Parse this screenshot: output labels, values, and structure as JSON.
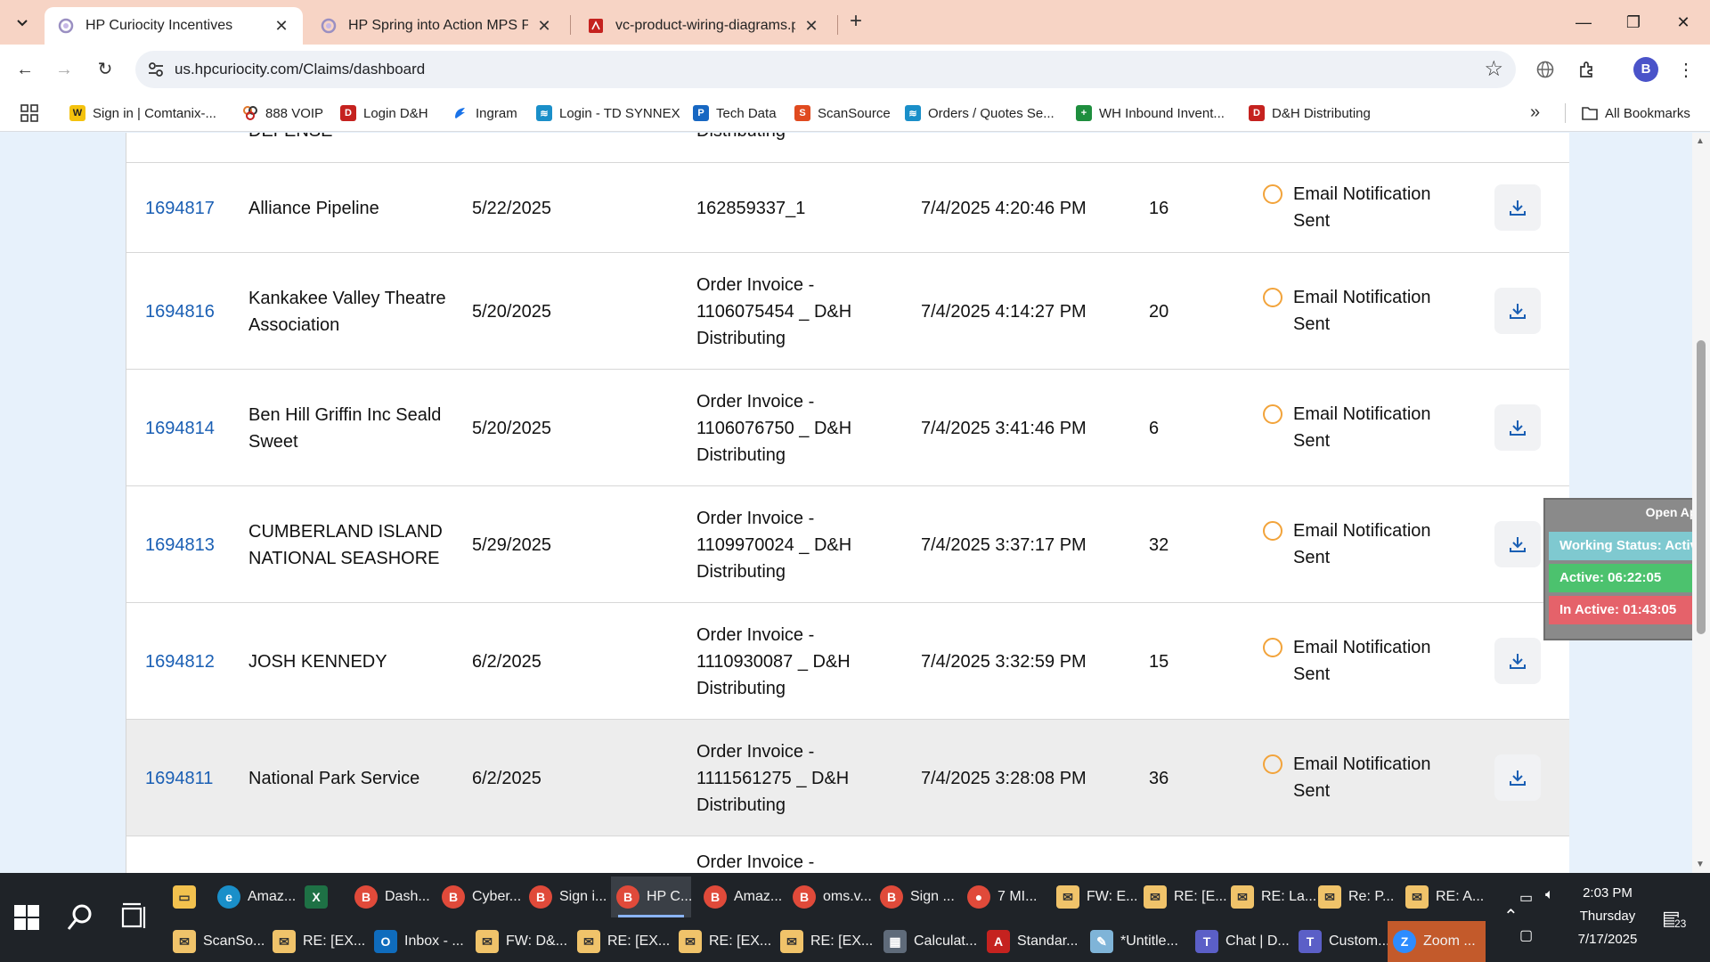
{
  "browser": {
    "tabs": [
      {
        "title": "HP Curiocity Incentives",
        "active": true
      },
      {
        "title": "HP Spring into Action MPS Pro",
        "active": false
      },
      {
        "title": "vc-product-wiring-diagrams.pd",
        "active": false
      }
    ],
    "url": "us.hpcuriocity.com/Claims/dashboard",
    "profile_initial": "B",
    "bookmarks": [
      "Sign in | Comtanix-...",
      "888 VOIP",
      "Login D&H",
      "Ingram",
      "Login - TD SYNNEX",
      "Tech Data",
      "ScanSource",
      "Orders / Quotes Se...",
      "WH Inbound Invent...",
      "D&H Distributing"
    ],
    "all_bookmarks": "All Bookmarks"
  },
  "table": {
    "partial_top": {
      "name": "DEFENSE",
      "invoice": "Distributing"
    },
    "rows": [
      {
        "id": "1694817",
        "name": "Alliance Pipeline",
        "date": "5/22/2025",
        "invoice": "162859337_1",
        "submitted": "7/4/2025 4:20:46 PM",
        "qty": "16",
        "status": "Email Notification Sent"
      },
      {
        "id": "1694816",
        "name": "Kankakee Valley Theatre Association",
        "date": "5/20/2025",
        "invoice": "Order Invoice - 1106075454 _ D&H Distributing",
        "submitted": "7/4/2025 4:14:27 PM",
        "qty": "20",
        "status": "Email Notification Sent"
      },
      {
        "id": "1694814",
        "name": "Ben Hill Griffin Inc Seald Sweet",
        "date": "5/20/2025",
        "invoice": "Order Invoice - 1106076750 _ D&H Distributing",
        "submitted": "7/4/2025 3:41:46 PM",
        "qty": "6",
        "status": "Email Notification Sent"
      },
      {
        "id": "1694813",
        "name": "CUMBERLAND ISLAND NATIONAL SEASHORE",
        "date": "5/29/2025",
        "invoice": "Order Invoice - 1109970024 _ D&H Distributing",
        "submitted": "7/4/2025 3:37:17 PM",
        "qty": "32",
        "status": "Email Notification Sent"
      },
      {
        "id": "1694812",
        "name": "JOSH KENNEDY",
        "date": "6/2/2025",
        "invoice": "Order Invoice - 1110930087 _ D&H Distributing",
        "submitted": "7/4/2025 3:32:59 PM",
        "qty": "15",
        "status": "Email Notification Sent"
      },
      {
        "id": "1694811",
        "name": "National Park Service",
        "date": "6/2/2025",
        "invoice": "Order Invoice - 1111561275 _ D&H Distributing",
        "submitted": "7/4/2025 3:28:08 PM",
        "qty": "36",
        "status": "Email Notification Sent"
      }
    ],
    "partial_bottom": {
      "invoice": "Order Invoice -"
    }
  },
  "widget": {
    "open_app": "Open App",
    "working_status": "Working Status: Active",
    "active": "Active: 06:22:05",
    "inactive": "In Active: 01:43:05"
  },
  "taskbar": {
    "row1": [
      "Amaz...",
      "",
      "Dash...",
      "Cyber...",
      "Sign i...",
      "HP C...",
      "Amaz...",
      "oms.v...",
      "Sign ...",
      "7 MI...",
      "FW: E...",
      "RE: [E...",
      "RE: La...",
      "Re: P...",
      "RE: A..."
    ],
    "row2": [
      "ScanSo...",
      "RE: [EX...",
      "Inbox - ...",
      "FW: D&...",
      "RE: [EX...",
      "RE: [EX...",
      "RE: [EX...",
      "Calculat...",
      "Standar...",
      "*Untitle...",
      "Chat | D...",
      "Custom...",
      "Zoom ..."
    ],
    "time": "2:03 PM",
    "day": "Thursday",
    "date": "7/17/2025",
    "notif_count": "23"
  }
}
